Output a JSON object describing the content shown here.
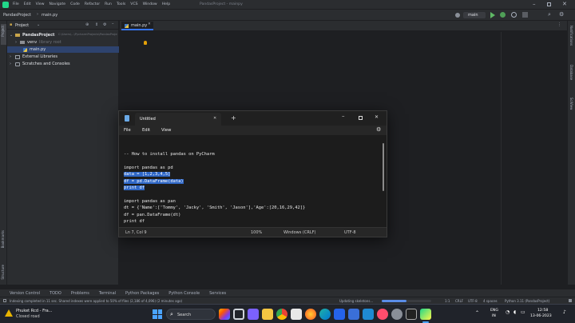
{
  "ide": {
    "window_title": "PandasProject - mainpy",
    "menu": [
      "File",
      "Edit",
      "View",
      "Navigate",
      "Code",
      "Refactor",
      "Run",
      "Tools",
      "VCS",
      "Window",
      "Help"
    ],
    "breadcrumb_project": "PandasProject",
    "breadcrumb_file": "main.py",
    "run_config": "main",
    "project_panel": {
      "header": "Project",
      "root": "PandasProject",
      "root_path": "C:\\Users\\...\\PycharmProjects\\PandasProject",
      "venv": "venv",
      "venv_note": "library root",
      "file": "main.py",
      "external": "External Libraries",
      "scratches": "Scratches and Consoles"
    },
    "editor_tab": "main.py",
    "bottom_tabs": [
      "Version Control",
      "TODO",
      "Problems",
      "Terminal",
      "Python Packages",
      "Python Console",
      "Services"
    ],
    "status_msg": "Indexing completed in 11 sec. Shared indexes were applied to 50% of files (2,186 of 4,096) (2 minutes ago)",
    "status_right": [
      "Updating skeletons...",
      "1:1",
      "CRLF",
      "UTF-8",
      "4 spaces",
      "Python 3.11 (PandasProject)"
    ],
    "left_tool_labels": [
      "Project",
      "Bookmarks",
      "Structure"
    ],
    "right_tool_labels": [
      "Notifications",
      "Database",
      "SciView"
    ]
  },
  "notepad": {
    "tab_title": "Untitled",
    "menu": [
      "File",
      "Edit",
      "View"
    ],
    "lines": [
      {
        "text": "-- How to install pandas on PyCharm",
        "sel": false
      },
      {
        "text": "",
        "sel": false
      },
      {
        "text": "import pandas as pd",
        "sel": false
      },
      {
        "text": "data = [1,2,3,4,5]",
        "sel": true
      },
      {
        "text": "df = pd.DataFrame(data)",
        "sel": true
      },
      {
        "text": "print df",
        "sel": true
      },
      {
        "text": "",
        "sel": false
      },
      {
        "text": "import pandas as pan",
        "sel": false
      },
      {
        "text": "dt = {'Name':['Tommy', 'Jacky', 'Smith', 'Jason'],'Age':[20,16,29,42]}",
        "sel": false
      },
      {
        "text": "df = pan.DataFrame(dt)",
        "sel": false
      },
      {
        "text": "print df",
        "sel": false
      }
    ],
    "status": {
      "position": "Ln 7, Col 9",
      "zoom": "100%",
      "eol": "Windows (CRLF)",
      "encoding": "UTF-8"
    }
  },
  "taskbar": {
    "weather_temp": "Phuket Rcd - Fra...",
    "weather_sub": "Closed road",
    "search_placeholder": "Search",
    "lang": "ENG",
    "lang_sub": "IN",
    "time": "12:58",
    "date": "13-06-2023"
  }
}
